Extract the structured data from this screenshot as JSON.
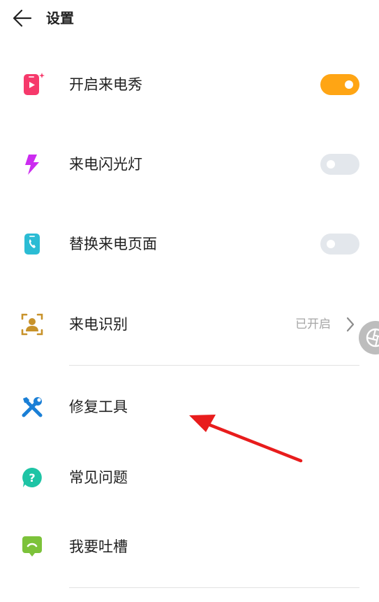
{
  "header": {
    "title": "设置"
  },
  "settings": {
    "call_show": {
      "label": "开启来电秀",
      "enabled": true
    },
    "flash": {
      "label": "来电闪光灯",
      "enabled": false
    },
    "replace_page": {
      "label": "替换来电页面",
      "enabled": false
    },
    "caller_id": {
      "label": "来电识别",
      "status": "已开启"
    }
  },
  "menu": {
    "repair_tool": {
      "label": "修复工具"
    },
    "faq": {
      "label": "常见问题"
    },
    "feedback": {
      "label": "我要吐槽"
    }
  },
  "colors": {
    "toggle_on": "#ffa514",
    "toggle_off": "#e3e7ec",
    "annotation_arrow": "#e81c1c"
  }
}
